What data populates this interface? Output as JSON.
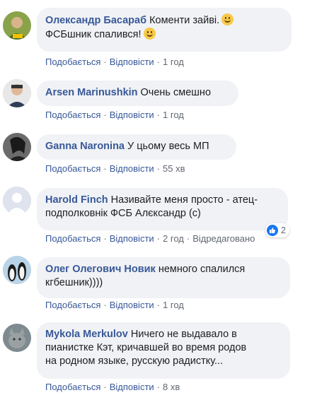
{
  "actions": {
    "like": "Подобається",
    "reply": "Відповісти",
    "separator": "·"
  },
  "comments": [
    {
      "author": "Олександр Басараб",
      "text_1": "Коменти зайві.",
      "text_2": "ФСБшник спалився!",
      "time": "1 год"
    },
    {
      "author": "Arsen Marinushkin",
      "text": "Очень смешно",
      "time": "1 год"
    },
    {
      "author": "Ganna Naronina",
      "text": "У цьому весь МП",
      "time": "55 хв"
    },
    {
      "author": "Harold Finch",
      "text_1": "Називайте меня просто - атец-",
      "text_2": "подполковнік ФСБ Алєксандр (с)",
      "time": "2 год",
      "edited": "Відредаговано",
      "reactions": "2"
    },
    {
      "author": "Олег Олегович Новик",
      "text_1": "немного спалился",
      "text_2": "кгбешник))))",
      "time": "1 год"
    },
    {
      "author": "Mykola Merkulov",
      "text_1": "Ничего не выдавало в",
      "text_2": "пианистке Кэт, кричавшей во время родов",
      "text_3": "на родном языке, русскую радистку...",
      "time": "8 хв"
    }
  ],
  "colors": {
    "link": "#385898",
    "bubble": "#f0f2f5",
    "meta": "#606770",
    "like": "#1877f2"
  }
}
